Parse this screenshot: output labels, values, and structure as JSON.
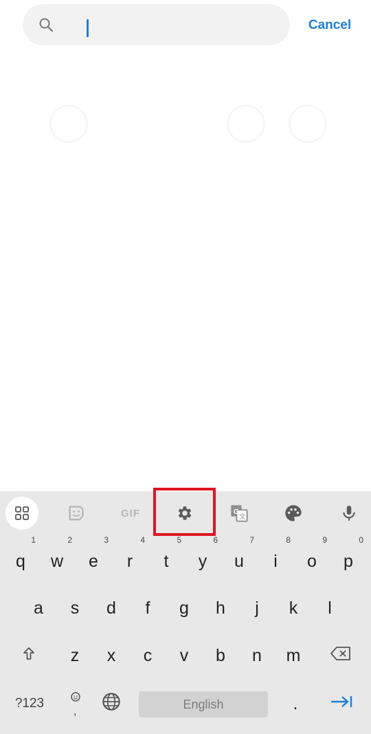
{
  "search": {
    "placeholder": "",
    "value": ""
  },
  "header": {
    "cancel_label": "Cancel"
  },
  "keyboard": {
    "toolbar": {
      "items": [
        "apps",
        "sticker",
        "gif",
        "settings",
        "translate",
        "theme",
        "voice"
      ],
      "gif_label": "GIF"
    },
    "row1": [
      {
        "key": "q",
        "hint": "1"
      },
      {
        "key": "w",
        "hint": "2"
      },
      {
        "key": "e",
        "hint": "3"
      },
      {
        "key": "r",
        "hint": "4"
      },
      {
        "key": "t",
        "hint": "5"
      },
      {
        "key": "y",
        "hint": "6"
      },
      {
        "key": "u",
        "hint": "7"
      },
      {
        "key": "i",
        "hint": "8"
      },
      {
        "key": "o",
        "hint": "9"
      },
      {
        "key": "p",
        "hint": "0"
      }
    ],
    "row2": [
      "a",
      "s",
      "d",
      "f",
      "g",
      "h",
      "j",
      "k",
      "l"
    ],
    "row3": [
      "z",
      "x",
      "c",
      "v",
      "b",
      "n",
      "m"
    ],
    "bottom": {
      "symbols_label": "?123",
      "space_label": "English",
      "period_label": "."
    }
  },
  "colors": {
    "accent": "#1c7fd6",
    "highlight": "#e0141f",
    "keyboard_bg": "#e8e8e8"
  }
}
